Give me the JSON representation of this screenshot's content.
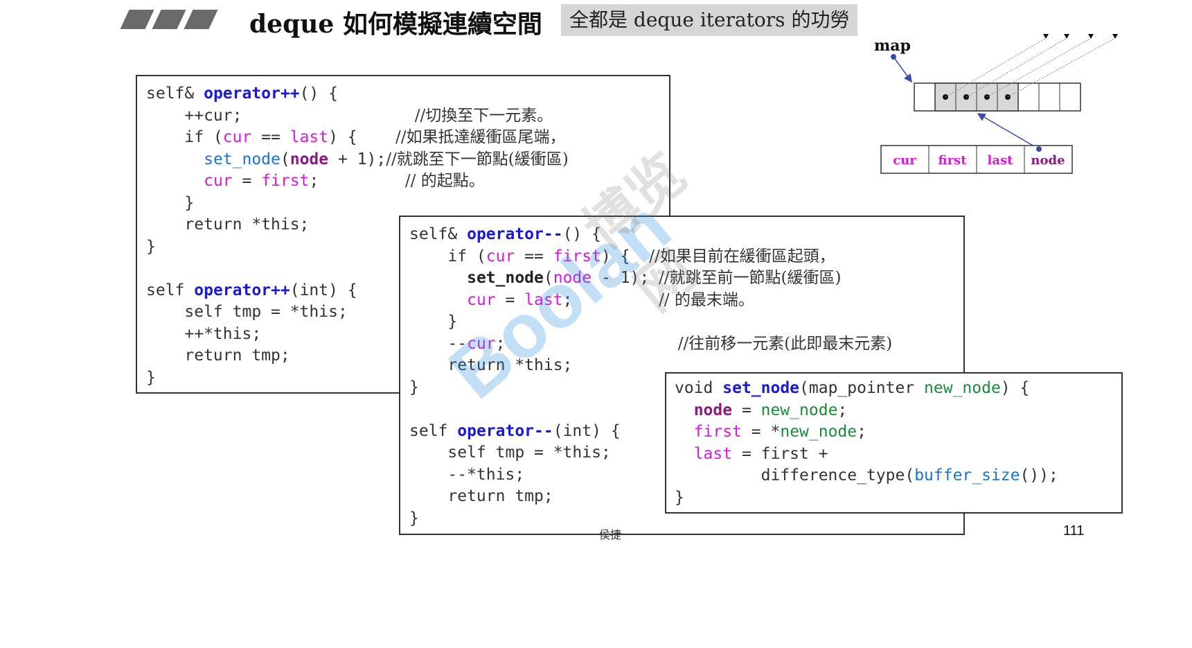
{
  "header": {
    "title": "deque 如何模擬連續空間",
    "subtitle": "全都是 deque iterators 的功勞"
  },
  "diagram": {
    "map_label": "map",
    "iterator_fields": [
      "cur",
      "first",
      "last",
      "node"
    ]
  },
  "page_number": "111",
  "footer_text": "侯捷",
  "watermark": {
    "text1": "Boolan",
    "text2": "博览网"
  },
  "colors": {
    "keyword_blue": "#1a1ad6",
    "member_magenta": "#d61adb",
    "field_purple": "#8b1a80",
    "call_blue": "#1a73d6",
    "param_green": "#1a8b3c",
    "subtitle_bg": "#d6d6d6"
  }
}
